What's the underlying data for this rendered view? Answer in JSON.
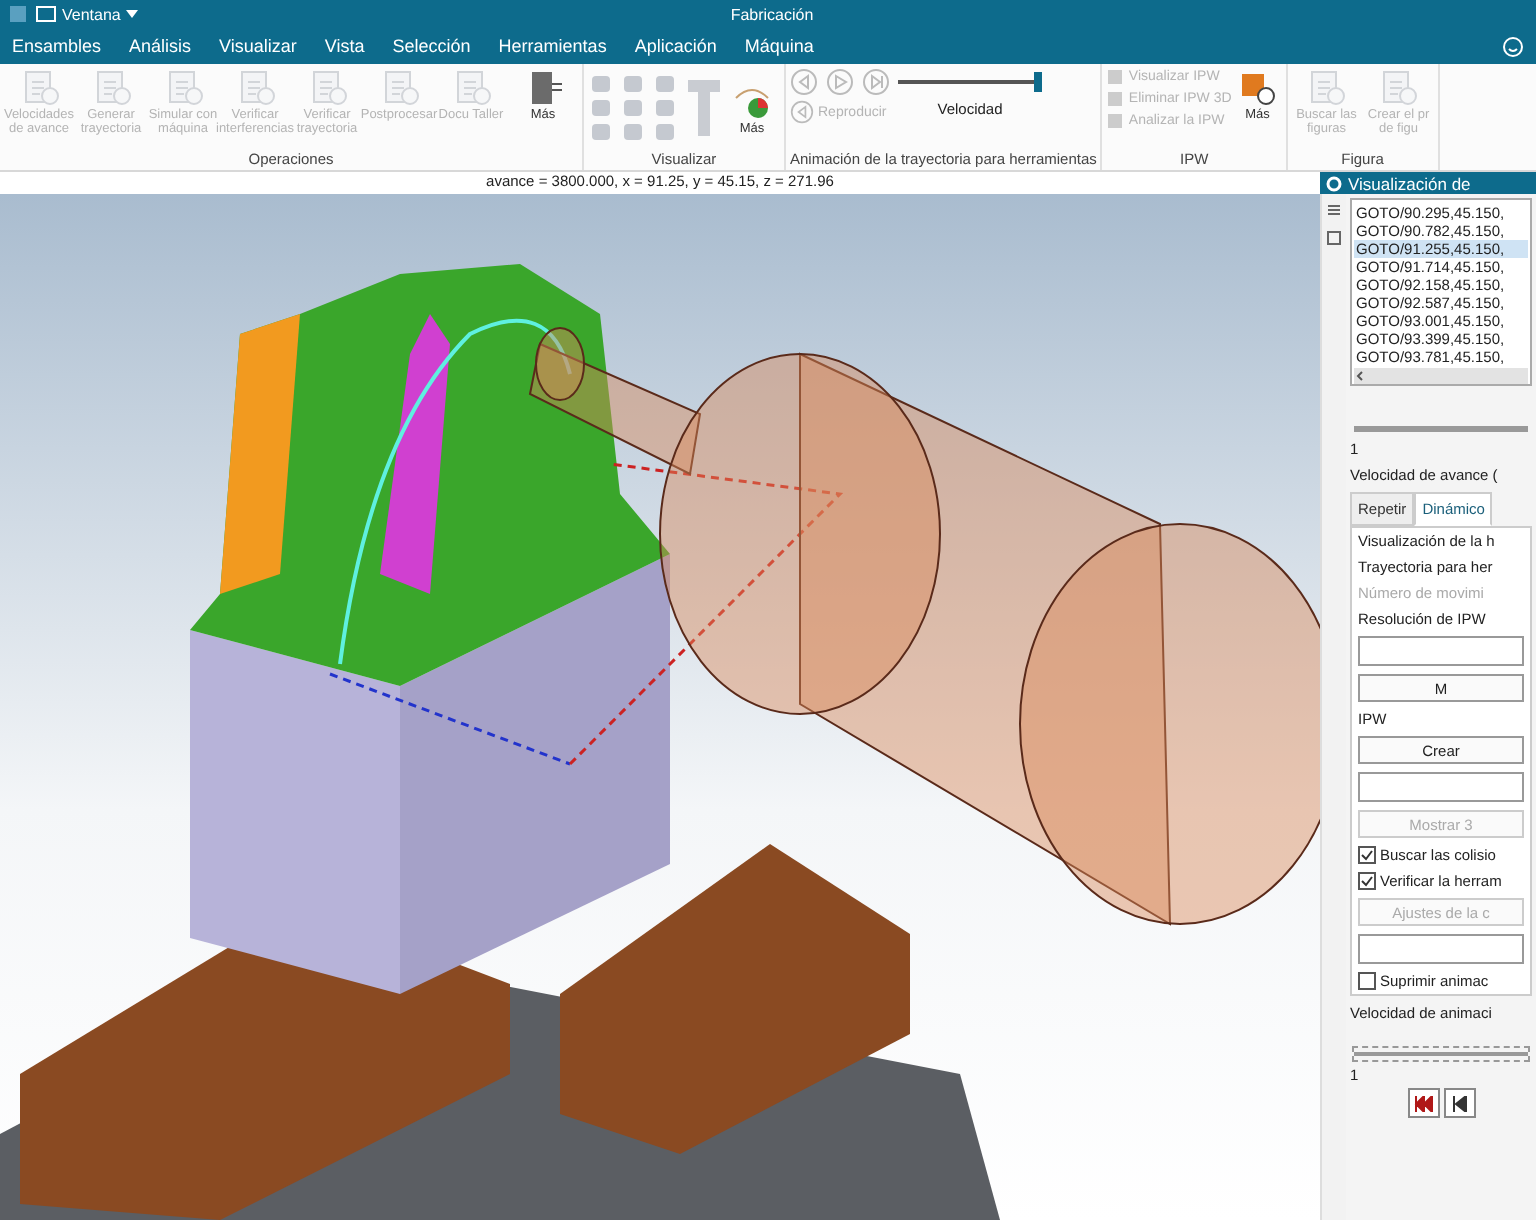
{
  "window": {
    "title": "Fabricación",
    "quick_access": "Ventana"
  },
  "menu": [
    "Ensambles",
    "Análisis",
    "Visualizar",
    "Vista",
    "Selección",
    "Herramientas",
    "Aplicación",
    "Máquina"
  ],
  "ribbon": {
    "groups": [
      {
        "kind": "large",
        "title": "Operaciones",
        "buttons": [
          {
            "label": "Velocidades de avance",
            "disabled": true
          },
          {
            "label": "Generar trayectoria",
            "disabled": true
          },
          {
            "label": "Simular con máquina",
            "disabled": true
          },
          {
            "label": "Verificar interferencias",
            "disabled": true
          },
          {
            "label": "Verificar trayectoria",
            "disabled": true
          },
          {
            "label": "Postprocesar",
            "disabled": true
          },
          {
            "label": "Docu Taller",
            "disabled": true
          },
          {
            "label": "Más",
            "disabled": false
          }
        ]
      },
      {
        "kind": "visualize",
        "title": "Visualizar",
        "more": "Más"
      },
      {
        "kind": "animation",
        "title": "Animación de la trayectoria para herramientas",
        "play": "Reproducir",
        "speed": "Velocidad",
        "level": 1
      },
      {
        "kind": "small",
        "title": "IPW",
        "buttons": [
          {
            "label": "Visualizar IPW",
            "disabled": true
          },
          {
            "label": "Eliminar IPW 3D",
            "disabled": true
          },
          {
            "label": "Analizar la IPW",
            "disabled": true
          }
        ],
        "more": "Más"
      },
      {
        "kind": "large",
        "title": "Figura",
        "buttons": [
          {
            "label": "Buscar las figuras",
            "disabled": true
          },
          {
            "label": "Crear el pr de figu",
            "disabled": true
          }
        ]
      }
    ]
  },
  "readout": "avance = 3800.000, x = 91.25, y = 45.15, z = 271.96",
  "panel": {
    "title": "Visualización de",
    "path_lines": [
      {
        "text": "GOTO/90.295,45.150,",
        "selected": false
      },
      {
        "text": "GOTO/90.782,45.150,",
        "selected": false
      },
      {
        "text": "GOTO/91.255,45.150,",
        "selected": true
      },
      {
        "text": "GOTO/91.714,45.150,",
        "selected": false
      },
      {
        "text": "GOTO/92.158,45.150,",
        "selected": false
      },
      {
        "text": "GOTO/92.587,45.150,",
        "selected": false
      },
      {
        "text": "GOTO/93.001,45.150,",
        "selected": false
      },
      {
        "text": "GOTO/93.399,45.150,",
        "selected": false
      },
      {
        "text": "GOTO/93.781,45.150,",
        "selected": false
      }
    ],
    "step_value": "1",
    "feed_label": "Velocidad de avance (",
    "tabs": [
      {
        "label": "Repetir",
        "selected": false
      },
      {
        "label": "Dinámico",
        "selected": true
      }
    ],
    "rows": [
      {
        "kind": "label",
        "text": "Visualización de la h",
        "disabled": false
      },
      {
        "kind": "label",
        "text": "Trayectoria para her",
        "disabled": false
      },
      {
        "kind": "label",
        "text": "Número de movimi",
        "disabled": true
      },
      {
        "kind": "label",
        "text": "Resolución de IPW",
        "disabled": false
      },
      {
        "kind": "field",
        "disabled": false
      },
      {
        "kind": "button",
        "text": "M",
        "disabled": false
      },
      {
        "kind": "label",
        "text": "IPW",
        "disabled": false
      },
      {
        "kind": "button",
        "text": "Crear",
        "disabled": false
      },
      {
        "kind": "field",
        "disabled": false
      },
      {
        "kind": "button",
        "text": "Mostrar 3",
        "disabled": true
      },
      {
        "kind": "checkbox",
        "text": "Buscar las colisio",
        "checked": true,
        "disabled": false
      },
      {
        "kind": "checkbox",
        "text": "Verificar la herram",
        "checked": true,
        "disabled": false
      },
      {
        "kind": "button",
        "text": "Ajustes de la c",
        "disabled": true
      },
      {
        "kind": "field",
        "disabled": false
      },
      {
        "kind": "checkbox",
        "text": "Suprimir animac",
        "checked": false,
        "disabled": false
      }
    ],
    "anim_label": "Velocidad de animaci",
    "anim_slider": {
      "level": 1
    },
    "anim_value": "1"
  }
}
